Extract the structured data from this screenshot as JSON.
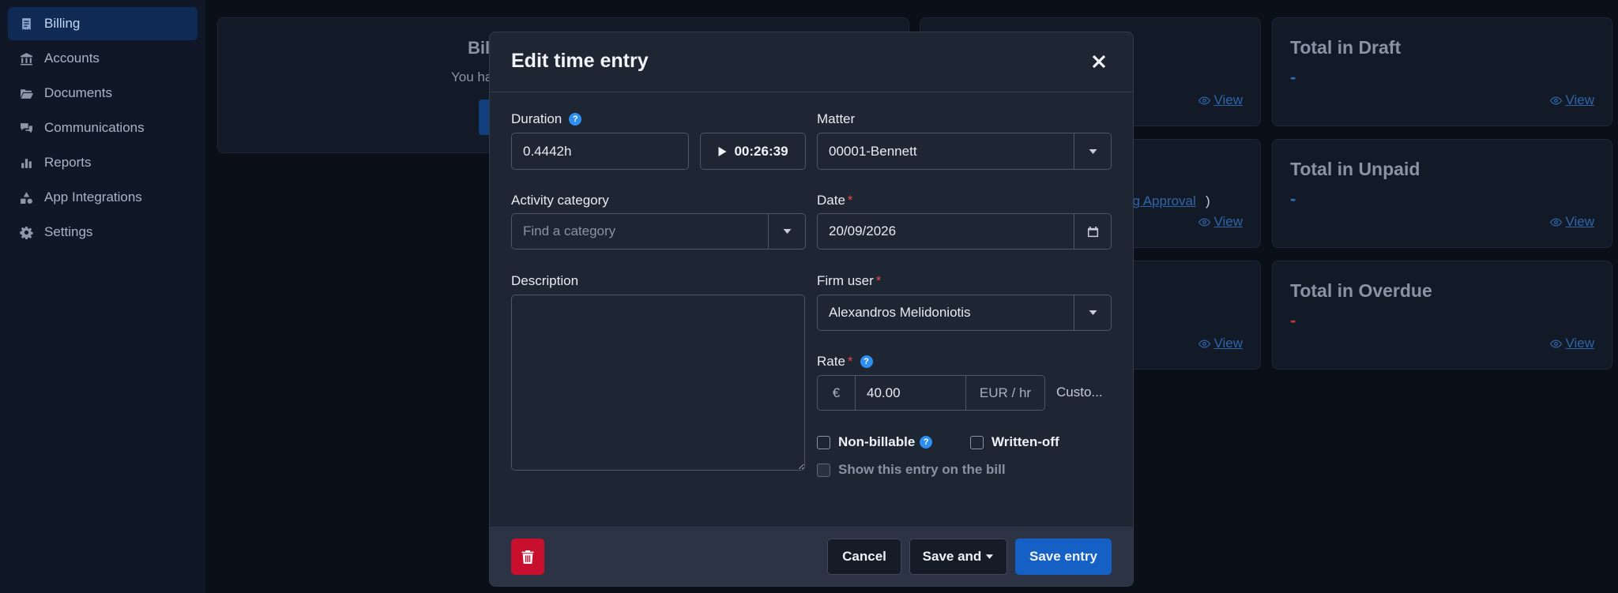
{
  "sidebar": {
    "items": [
      {
        "label": "Billing",
        "icon": "billing-icon",
        "active": true
      },
      {
        "label": "Accounts",
        "icon": "bank-icon"
      },
      {
        "label": "Documents",
        "icon": "folder-icon"
      },
      {
        "label": "Communications",
        "icon": "chat-icon"
      },
      {
        "label": "Reports",
        "icon": "bar-chart-icon"
      },
      {
        "label": "App Integrations",
        "icon": "shapes-icon"
      },
      {
        "label": "Settings",
        "icon": "gear-icon"
      }
    ]
  },
  "background": {
    "bill_card_title": "Bil",
    "bill_card_sub": "You ha",
    "partial_link": "ng Approval",
    "partial_paren": ")",
    "view_label": "View",
    "totals": [
      {
        "title": "Total in Draft",
        "value": "-",
        "color": "#2f6fb8"
      },
      {
        "title": "Total in Unpaid",
        "value": "-",
        "color": "#2f6fb8"
      },
      {
        "title": "Total in Overdue",
        "value": "-",
        "color": "#c0392b"
      }
    ]
  },
  "modal": {
    "title": "Edit time entry",
    "duration": {
      "label": "Duration",
      "value": "0.4442h",
      "timer": "00:26:39"
    },
    "matter": {
      "label": "Matter",
      "value": "00001-Bennett"
    },
    "activity": {
      "label": "Activity category",
      "placeholder": "Find a category"
    },
    "date": {
      "label": "Date",
      "value": "20/09/2026"
    },
    "description": {
      "label": "Description",
      "value": ""
    },
    "firm_user": {
      "label": "Firm user",
      "value": "Alexandros Melidoniotis"
    },
    "rate": {
      "label": "Rate",
      "currency": "€",
      "value": "40.00",
      "unit": "EUR / hr",
      "custom": "Custo..."
    },
    "checks": {
      "non_billable": "Non-billable",
      "written_off": "Written-off",
      "show_on_bill": "Show this entry on the bill"
    },
    "required_mark": "*",
    "help_mark": "?",
    "footer": {
      "cancel": "Cancel",
      "save_and": "Save and",
      "save": "Save entry"
    }
  },
  "colors": {
    "primary": "#1560c5",
    "danger": "#c8102e",
    "help": "#2f8ff0"
  }
}
